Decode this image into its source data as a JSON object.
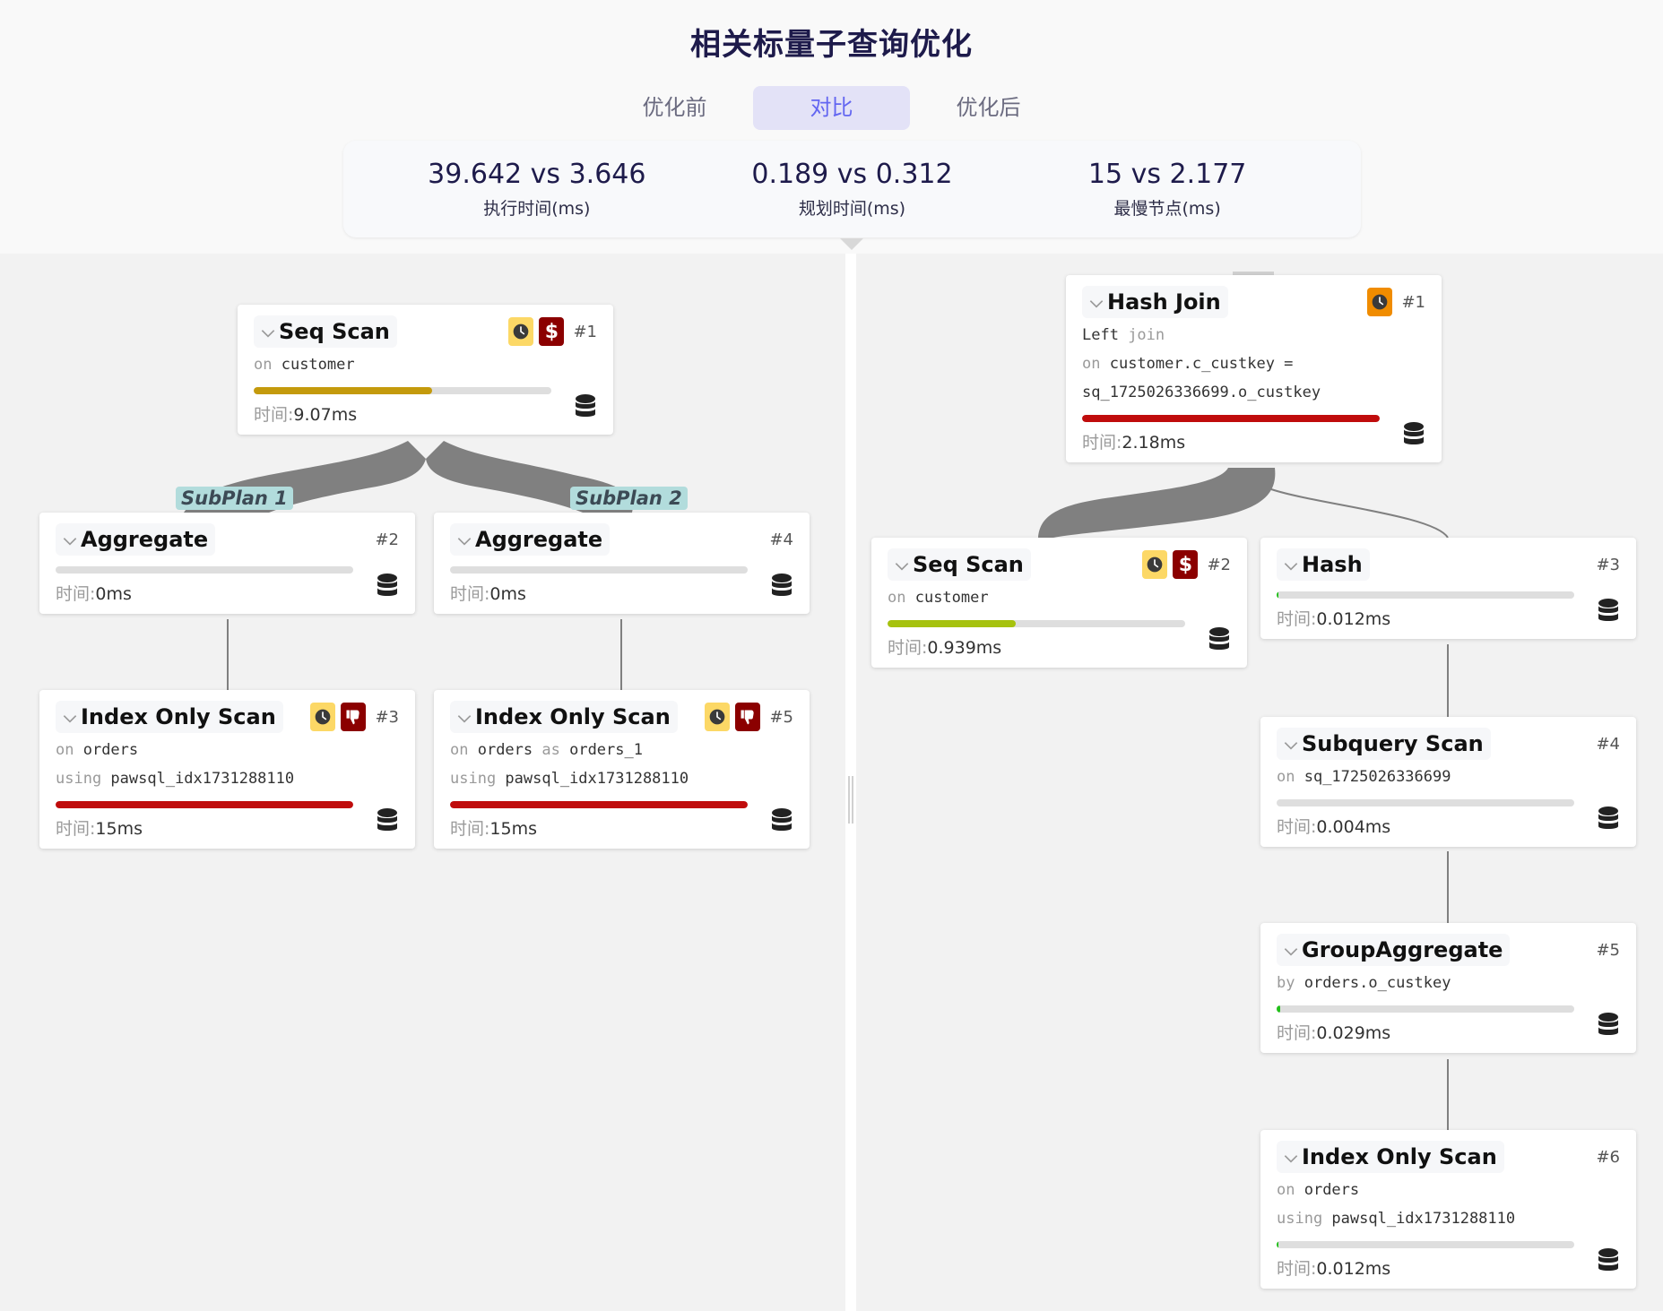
{
  "title": "相关标量子查询优化",
  "tabs": [
    {
      "label": "优化前",
      "active": false
    },
    {
      "label": "对比",
      "active": true
    },
    {
      "label": "优化后",
      "active": false
    }
  ],
  "stats": [
    {
      "value": "39.642 vs 3.646",
      "label": "执行时间(ms)"
    },
    {
      "value": "0.189 vs 0.312",
      "label": "规划时间(ms)"
    },
    {
      "value": "15 vs 2.177",
      "label": "最慢节点(ms)"
    }
  ],
  "time_label": "时间:",
  "colors": {
    "accent": "#6366f1",
    "bar_red": "#c00c0c",
    "bar_gold": "#c49a0c",
    "bar_lime": "#a6c20e",
    "bar_green": "#22c01a",
    "badge_yellow": "#fcd866",
    "badge_orange": "#f08c00",
    "badge_darkred": "#8b0000",
    "subplan_bg": "#b2dcdc"
  },
  "left_plan": {
    "subplans": [
      "SubPlan 1",
      "SubPlan 2"
    ],
    "nodes": [
      {
        "id": "#1",
        "name": "Seq Scan",
        "details": [
          [
            {
              "k": "on "
            },
            {
              "v": "customer"
            }
          ]
        ],
        "badges": [
          "clock-yellow",
          "dollar"
        ],
        "progress": 0.6,
        "bar_color": "#c49a0c",
        "time": "9.07ms"
      },
      {
        "id": "#2",
        "name": "Aggregate",
        "details": [],
        "badges": [],
        "progress": 0,
        "bar_color": "#22c01a",
        "time": "0ms"
      },
      {
        "id": "#4",
        "name": "Aggregate",
        "details": [],
        "badges": [],
        "progress": 0,
        "bar_color": "#22c01a",
        "time": "0ms"
      },
      {
        "id": "#3",
        "name": "Index Only Scan",
        "details": [
          [
            {
              "k": "on "
            },
            {
              "v": "orders"
            }
          ],
          [
            {
              "k": "using "
            },
            {
              "v": "pawsql_idx1731288110"
            }
          ]
        ],
        "badges": [
          "clock-yellow",
          "thumbs-down"
        ],
        "progress": 1.0,
        "bar_color": "#c00c0c",
        "time": "15ms"
      },
      {
        "id": "#5",
        "name": "Index Only Scan",
        "details": [
          [
            {
              "k": "on "
            },
            {
              "v": "orders"
            },
            {
              "k": " as "
            },
            {
              "v": "orders_1"
            }
          ],
          [
            {
              "k": "using "
            },
            {
              "v": "pawsql_idx1731288110"
            }
          ]
        ],
        "badges": [
          "clock-yellow",
          "thumbs-down"
        ],
        "progress": 1.0,
        "bar_color": "#c00c0c",
        "time": "15ms"
      }
    ]
  },
  "right_plan": {
    "nodes": [
      {
        "id": "#1",
        "name": "Hash Join",
        "details": [
          [
            {
              "v": "Left"
            },
            {
              "k": " join"
            }
          ],
          [
            {
              "k": "on "
            },
            {
              "v": "customer.c_custkey ="
            }
          ],
          [
            {
              "v": "sq_1725026336699.o_custkey"
            }
          ]
        ],
        "badges": [
          "clock-orange"
        ],
        "progress": 1.0,
        "bar_color": "#c00c0c",
        "time": "2.18ms"
      },
      {
        "id": "#2",
        "name": "Seq Scan",
        "details": [
          [
            {
              "k": "on "
            },
            {
              "v": "customer"
            }
          ]
        ],
        "badges": [
          "clock-yellow",
          "dollar"
        ],
        "progress": 0.43,
        "bar_color": "#a6c20e",
        "time": "0.939ms"
      },
      {
        "id": "#3",
        "name": "Hash",
        "details": [],
        "badges": [],
        "progress": 0.006,
        "bar_color": "#22c01a",
        "time": "0.012ms"
      },
      {
        "id": "#4",
        "name": "Subquery Scan",
        "details": [
          [
            {
              "k": "on "
            },
            {
              "v": "sq_1725026336699"
            }
          ]
        ],
        "badges": [],
        "progress": 0.0,
        "bar_color": "#22c01a",
        "time": "0.004ms"
      },
      {
        "id": "#5",
        "name": "GroupAggregate",
        "details": [
          [
            {
              "k": "by "
            },
            {
              "v": "orders.o_custkey"
            }
          ]
        ],
        "badges": [],
        "progress": 0.013,
        "bar_color": "#22c01a",
        "time": "0.029ms"
      },
      {
        "id": "#6",
        "name": "Index Only Scan",
        "details": [
          [
            {
              "k": "on "
            },
            {
              "v": "orders"
            }
          ],
          [
            {
              "k": "using "
            },
            {
              "v": "pawsql_idx1731288110"
            }
          ]
        ],
        "badges": [],
        "progress": 0.006,
        "bar_color": "#22c01a",
        "time": "0.012ms"
      }
    ]
  }
}
